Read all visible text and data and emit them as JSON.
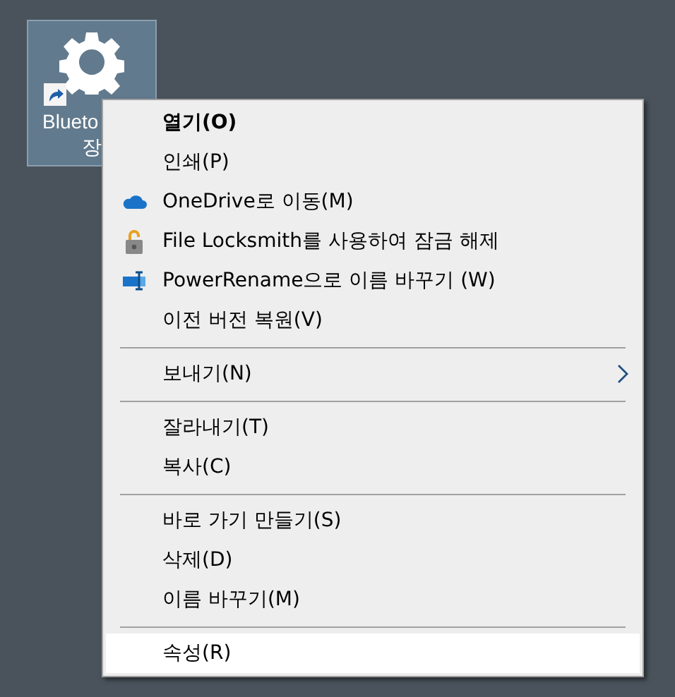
{
  "desktop_icon": {
    "label_lines": [
      "Blueto",
      "장"
    ],
    "selected": true
  },
  "context_menu": [
    {
      "kind": "plain",
      "label": "열기(O)",
      "default": true,
      "selected": false
    },
    {
      "kind": "plain",
      "label": "인쇄(P)",
      "default": false,
      "selected": false
    },
    {
      "kind": "cloud",
      "label": "OneDrive로 이동(M)",
      "default": false,
      "selected": false
    },
    {
      "kind": "lock",
      "label": "File Locksmith를 사용하여 잠금 해제",
      "default": false,
      "selected": false
    },
    {
      "kind": "rename",
      "label": "PowerRename으로 이름 바꾸기 (W)",
      "default": false,
      "selected": false
    },
    {
      "kind": "plain",
      "label": "이전 버전 복원(V)",
      "default": false,
      "selected": false
    },
    {
      "kind": "separator"
    },
    {
      "kind": "submenu",
      "label": "보내기(N)",
      "default": false,
      "selected": false
    },
    {
      "kind": "separator"
    },
    {
      "kind": "plain",
      "label": "잘라내기(T)",
      "default": false,
      "selected": false
    },
    {
      "kind": "plain",
      "label": "복사(C)",
      "default": false,
      "selected": false
    },
    {
      "kind": "separator"
    },
    {
      "kind": "plain",
      "label": "바로 가기 만들기(S)",
      "default": false,
      "selected": false
    },
    {
      "kind": "plain",
      "label": "삭제(D)",
      "default": false,
      "selected": false
    },
    {
      "kind": "plain",
      "label": "이름 바꾸기(M)",
      "default": false,
      "selected": false
    },
    {
      "kind": "separator"
    },
    {
      "kind": "plain",
      "label": "속성(R)",
      "default": false,
      "selected": true
    }
  ]
}
